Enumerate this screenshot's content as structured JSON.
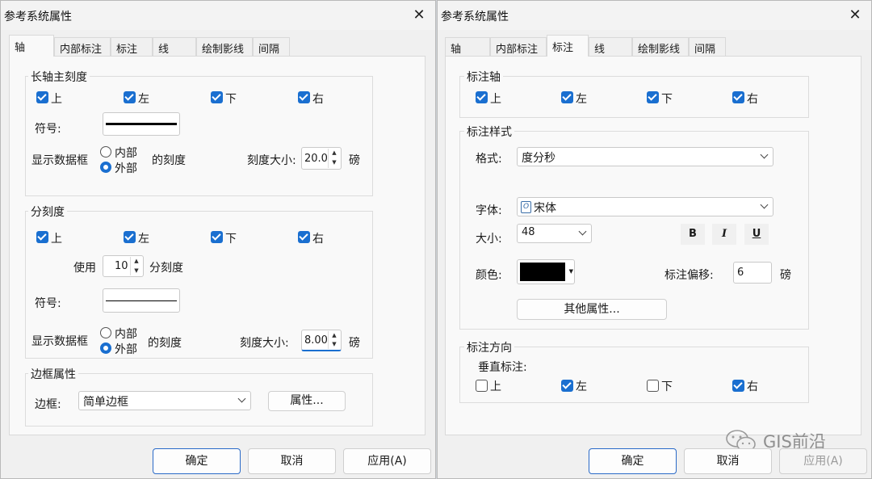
{
  "left": {
    "title": "参考系统属性",
    "tabs": [
      "轴",
      "内部标注",
      "标注",
      "线",
      "绘制影线",
      "间隔"
    ],
    "major": {
      "title": "长轴主刻度",
      "checks": [
        {
          "label": "上",
          "checked": true
        },
        {
          "label": "左",
          "checked": true
        },
        {
          "label": "下",
          "checked": true
        },
        {
          "label": "右",
          "checked": true
        }
      ],
      "symbol_label": "符号:",
      "show_label": "显示数据框",
      "radio_inner": "内部",
      "radio_outer": "外部",
      "tick_suffix": "的刻度",
      "size_label": "刻度大小:",
      "size_value": "20.0",
      "unit": "磅"
    },
    "minor": {
      "title": "分刻度",
      "checks": [
        {
          "label": "上",
          "checked": true
        },
        {
          "label": "左",
          "checked": true
        },
        {
          "label": "下",
          "checked": true
        },
        {
          "label": "右",
          "checked": true
        }
      ],
      "use_label": "使用",
      "use_value": "10",
      "use_suffix": "分刻度",
      "symbol_label": "符号:",
      "show_label": "显示数据框",
      "radio_inner": "内部",
      "radio_outer": "外部",
      "tick_suffix": "的刻度",
      "size_label": "刻度大小:",
      "size_value": "8.00",
      "unit": "磅"
    },
    "border": {
      "title": "边框属性",
      "label": "边框:",
      "value": "简单边框",
      "props_button": "属性..."
    },
    "buttons": {
      "ok": "确定",
      "cancel": "取消",
      "apply": "应用(A)"
    }
  },
  "right": {
    "title": "参考系统属性",
    "tabs": [
      "轴",
      "内部标注",
      "标注",
      "线",
      "绘制影线",
      "间隔"
    ],
    "axis": {
      "title": "标注轴",
      "checks": [
        {
          "label": "上",
          "checked": true
        },
        {
          "label": "左",
          "checked": true
        },
        {
          "label": "下",
          "checked": true
        },
        {
          "label": "右",
          "checked": true
        }
      ]
    },
    "style": {
      "title": "标注样式",
      "format_label": "格式:",
      "format_value": "度分秒",
      "font_label": "字体:",
      "font_value": "宋体",
      "size_label": "大小:",
      "size_value": "48",
      "bold": "B",
      "italic": "I",
      "underline": "U",
      "color_label": "颜色:",
      "color": "#000000",
      "offset_label": "标注偏移:",
      "offset_value": "6",
      "unit": "磅",
      "more_button": "其他属性..."
    },
    "direction": {
      "title": "标注方向",
      "vertical_label": "垂直标注:",
      "checks": [
        {
          "label": "上",
          "checked": false
        },
        {
          "label": "左",
          "checked": true
        },
        {
          "label": "下",
          "checked": false
        },
        {
          "label": "右",
          "checked": true
        }
      ]
    },
    "buttons": {
      "ok": "确定",
      "cancel": "取消",
      "apply": "应用(A)"
    }
  },
  "watermark": "GIS前沿",
  "colors": {
    "accent": "#1a6fd0"
  }
}
